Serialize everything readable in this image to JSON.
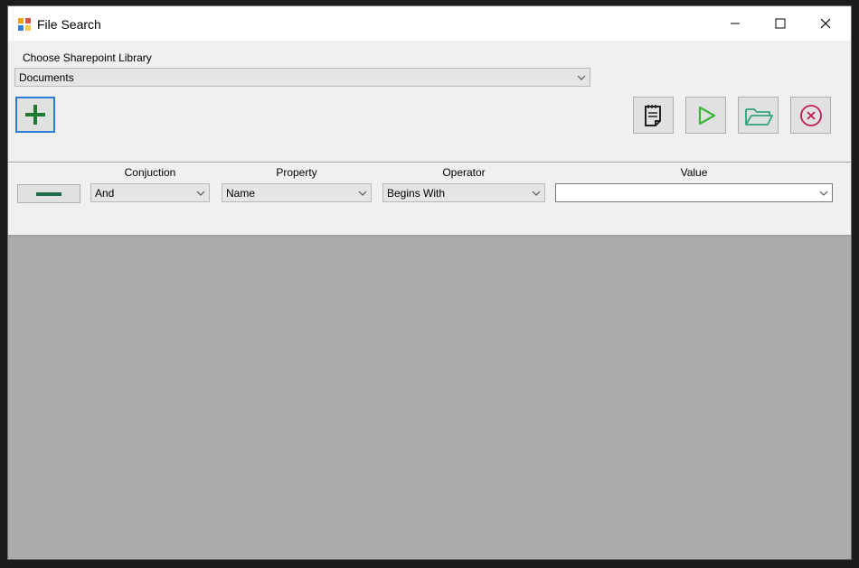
{
  "window": {
    "title": "File Search"
  },
  "top": {
    "library_label": "Choose Sharepoint Library",
    "library_value": "Documents"
  },
  "filter": {
    "headers": {
      "conjunction": "Conjuction",
      "property": "Property",
      "operator": "Operator",
      "value": "Value"
    },
    "conjunction_value": "And",
    "property_value": "Name",
    "operator_value": "Begins With",
    "value_value": ""
  },
  "colors": {
    "add": "#1e7a2e",
    "run": "#3cb53c",
    "folder": "#2fa57a",
    "cancel": "#c2185b",
    "focus": "#2b7ad4"
  }
}
